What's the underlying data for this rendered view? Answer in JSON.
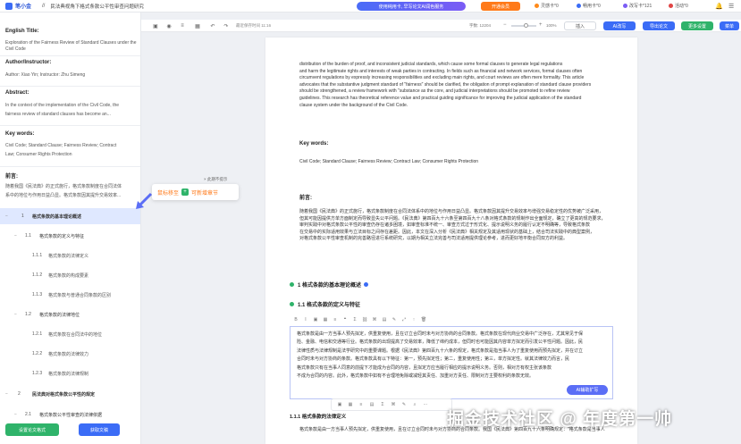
{
  "app": {
    "logo_text": "笔小金",
    "title_sep": "//",
    "doc_title": "民法典视角下格式条款公平性审查问题研究"
  },
  "header": {
    "promo_label": "使用纯用卡, 早写论文AI润色服务",
    "member_label": "开通会员",
    "stats": [
      {
        "icon": "coin-icon",
        "label": "灵感卡*0",
        "color": "#ff8a1a"
      },
      {
        "icon": "card-icon",
        "label": "畅用卡*0",
        "color": "#3b6cf6"
      },
      {
        "icon": "diamond-icon",
        "label": "改写卡*121",
        "color": "#7b5cf5"
      },
      {
        "icon": "gift-icon",
        "label": "活动*0",
        "color": "#e04545"
      }
    ]
  },
  "sidebar": {
    "english_title_label": "English Title:",
    "english_title": "Exploration of the Fairness Review of Standard Clauses under the Civil Code",
    "author_label": "Author/Instructor:",
    "author": "Author: Xiao Yin; Instructor: Zhu Simeng",
    "abstract_label": "Abstract:",
    "abstract_1": "In the context of the implementation of the Civil Code, the",
    "abstract_2": "fairness review of standard clauses has become an...",
    "keywords_label": "Key words:",
    "keywords_1": "Civil Code; Standard Clause; Fairness Review; Contract",
    "keywords_2": "Law; Consumer Rights Protection",
    "preface_label": "前言:",
    "preface_1": "随着我国《民法典》的正式施行，格式条款制度在合同法体",
    "preface_2": "系中的地位与作用日益凸显。格式条款因其提升交易效率...",
    "tree": [
      {
        "toggle": "−",
        "num": "1",
        "label": "格式条款的基本理论概述",
        "level": 0,
        "active": true
      },
      {
        "toggle": "−",
        "num": "1.1",
        "label": "格式条款的定义与特征",
        "level": 1,
        "active": false
      },
      {
        "toggle": "",
        "num": "1.1.1",
        "label": "格式条款的法律定义",
        "level": 2,
        "active": false
      },
      {
        "toggle": "",
        "num": "1.1.2",
        "label": "格式条款的构成要素",
        "level": 2,
        "active": false
      },
      {
        "toggle": "",
        "num": "1.1.3",
        "label": "格式条款与普通合同条款的区别",
        "level": 2,
        "active": false
      },
      {
        "toggle": "−",
        "num": "1.2",
        "label": "格式条款的法律地位",
        "level": 1,
        "active": false
      },
      {
        "toggle": "",
        "num": "1.2.1",
        "label": "格式条款在合同法中的地位",
        "level": 2,
        "active": false
      },
      {
        "toggle": "",
        "num": "1.2.2",
        "label": "格式条款的法律效力",
        "level": 2,
        "active": false
      },
      {
        "toggle": "",
        "num": "1.2.3",
        "label": "格式条款的法律规制",
        "level": 2,
        "active": false
      },
      {
        "toggle": "−",
        "num": "2",
        "label": "民法典对格式条款公平性的规定",
        "level": 0,
        "active": false
      },
      {
        "toggle": "−",
        "num": "2.1",
        "label": "格式条款公平性审查的法律依据",
        "level": 1,
        "active": false
      }
    ],
    "btn_left": "设置论文格式",
    "btn_right": "获取文稿"
  },
  "tooltip": {
    "text_pre": "鼠标移至",
    "plus": "+",
    "text_post": "可新增章节",
    "note": "× 此期不提示"
  },
  "toolbar": {
    "icons": [
      "layout-icon",
      "eye-icon",
      "list-icon",
      "grid-icon",
      "undo-icon",
      "redo-icon",
      "format-icon"
    ],
    "autosave": "最近保存时间 11:16",
    "word_count": "字数: 12204",
    "zoom": "100%",
    "btn_insert": "插入",
    "btn_ai": "AI改写",
    "btn_export": "导出论文",
    "btn_more": "更多设置",
    "btn_menu": "菜单"
  },
  "paper": {
    "abstract_lines": [
      "distribution of the burden of proof, and inconsistent judicial standards, which cause some formal clauses to generate legal regulations",
      "and harm the legitimate rights and interests of weak parties in contracting. In fields such as financial and network services, formal clauses often",
      "circumvent regulations by expressly increasing responsibilities and excluding main rights, and court reviews are often mere formality. This article",
      "advocates that the substantive judgment standard of \"fairness\" should be clarified, the obligation of prompt explanation of standard clause providers",
      "should be strengthened, a review framework with \"substance as the core, and judicial interpretations should be promoted to refine review",
      "guidelines. This research has theoretical reference value and practical guiding significance for improving the judicial application of the standard",
      "clause system under the background of the Civil Code."
    ],
    "keywords_title": "Key words:",
    "keywords_text": "Civil Code; Standard Clause; Fairness Review; Contract Law; Consumer Rights Protection",
    "preface_title": "前言:",
    "preface_lines": [
      "随着我国《民法典》的正式施行，格式条款制度在合同法体系中的地位与作用日益凸显。格式条款因其提升交易效率与增强交易稳定性的优势被广泛采用，",
      "但其可能因提供方单方面制定而导致显失公平问题。《民法典》第四百九十六条至第四百九十八条对格式条款的规制作出全面规定，确立了更高的规范要求，",
      "审判实践中对格式条款公平性的审查仍存在诸多困境，如审查标准不统一、审查方式过于形式化、提示说明义务的履行认定不明确等，导致格式条款",
      "在交易中的实际适用效果与立法目标之间存在差距。因此，本文在深入分析《民法典》相关规定及其适用现状的基础上，结合司法实践中的典型案例，",
      "对格式条款公平性审查机制的完善路径进行系统研究，以期为相关立法完善与司法适用提供理论参考，进而更好地平衡合同双方的利益。"
    ],
    "sec1_title": "1 格式条款的基本理论概述",
    "sec11_title": "1.1 格式条款的定义与特征",
    "edit_lines": [
      "格式条款是由一方当事人预先拟定，供重复使用，且在订立合同时未与对方协商的合同条款。格式条款在现代商业交易中广泛存在，尤其常见于保",
      "险、金融、电信和交通等行业。格式条款的出现提高了交易效率，降低了缔约成本，但同时也可能因其内容单方拟定而引发公平性问题。因此，民",
      "法律性质与法律规制是法学研究中的重要课题。根据《民法典》第四百九十六条的规定，格式条款是指当事人为了重复使用而预先拟定，并在订立",
      "合同时未与对方协商的条款。格式条款具有以下特征：第一，预先拟定性；第二，重复使用性；第三，单方拟定性。就其法律效力而言，民",
      "格式条款只有在当事人同意的前提下才能成为合同的内容，且拟定方应当履行相应的提示说明义务。否则，相对方有权主张该条款",
      "不成为合同的内容。此外，格式条款中如有不合理地免除或减轻其责任、加重对方责任、限制对方主要权利的条款无效。"
    ],
    "ai_btn": "AI辅助扩写",
    "sub111_title": "1.1.1 格式条款的法律定义",
    "foot_line": "格式条款是由一方当事人预先拟定，供重复使用，且在订立合同时未与对方协商的合同条款。我国《民法典》第四百九十六条明确规定：\"格式条款是当事人"
  },
  "watermark": "掘金技术社区 @ 年度第一帅"
}
